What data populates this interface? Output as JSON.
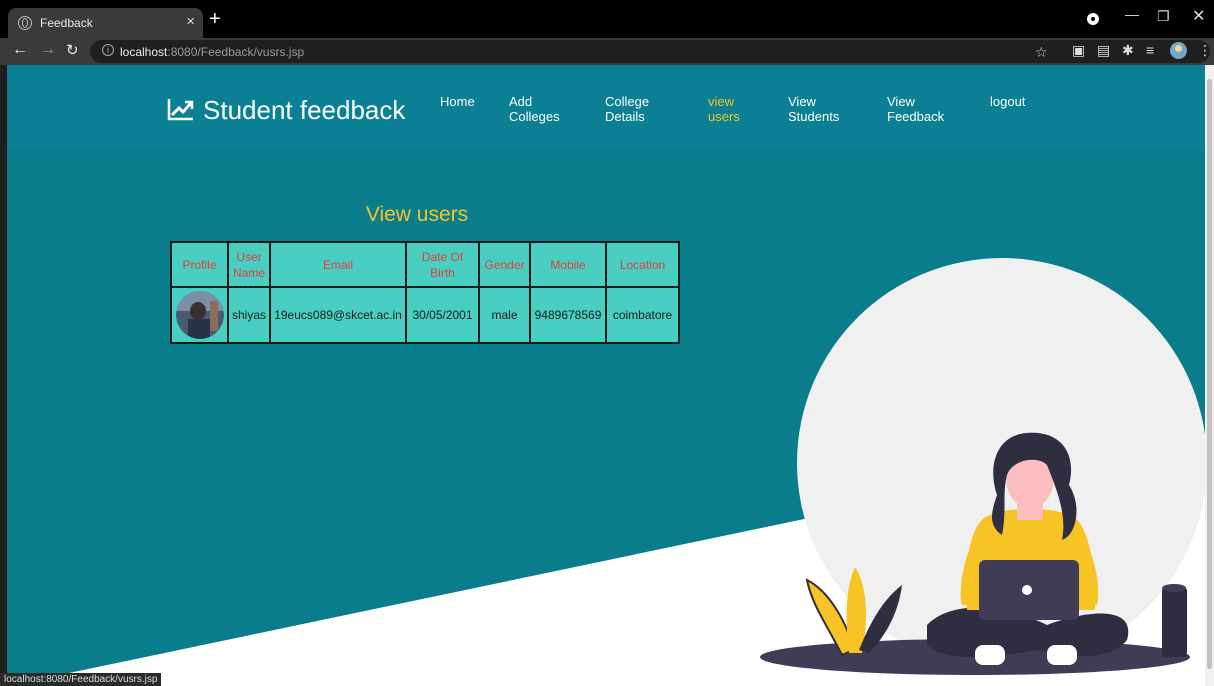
{
  "browser": {
    "tab_title": "Feedback",
    "tab_close": "×",
    "new_tab": "+",
    "url_host": "localhost",
    "url_path": ":8080/Feedback/vusrs.jsp",
    "status_url": "localhost:8080/Feedback/vusrs.jsp"
  },
  "site": {
    "brand": "Student feedback",
    "nav": [
      {
        "line1": "Home",
        "line2": ""
      },
      {
        "line1": "Add",
        "line2": "Colleges"
      },
      {
        "line1": "College",
        "line2": "Details"
      },
      {
        "line1": "view",
        "line2": "users"
      },
      {
        "line1": "View",
        "line2": "Students"
      },
      {
        "line1": "View",
        "line2": "Feedback"
      },
      {
        "line1": "logout",
        "line2": ""
      }
    ],
    "active_nav_color": "#f6c424"
  },
  "main": {
    "heading": "View users",
    "table": {
      "headers": [
        "Profile",
        "User Name",
        "Email",
        "Date Of Birth",
        "Gender",
        "Mobile",
        "Location"
      ],
      "rows": [
        {
          "user_name": "shiyas",
          "email": "19eucs089@skcet.ac.in",
          "dob": "30/05/2001",
          "gender": "male",
          "mobile": "9489678569",
          "location": "coimbatore"
        }
      ]
    }
  },
  "colors": {
    "header": "#0b7f94",
    "background": "#0a7d8c",
    "table": "#48cfc1",
    "header_text": "#e24040",
    "accent": "#f6c424"
  }
}
